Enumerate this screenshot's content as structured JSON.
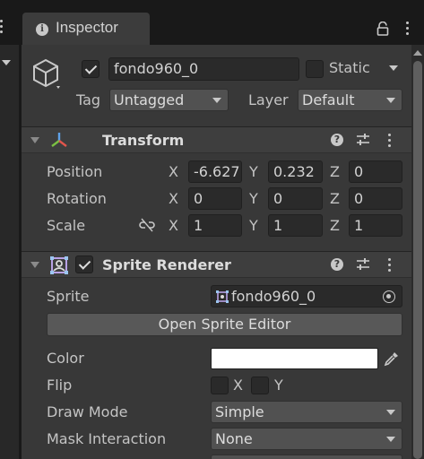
{
  "tab": {
    "title": "Inspector",
    "icon": "info-icon"
  },
  "icons": {
    "lock": "lock-icon",
    "tab_menu": "kebab-menu-icon",
    "gameobject": "cube-icon",
    "transform": "transform-axes-icon",
    "sprite_renderer": "sprite-renderer-icon",
    "help": "help-icon",
    "presets": "preset-sliders-icon",
    "constrain": "link-broken-icon",
    "object_picker": "object-picker-icon",
    "eyedropper": "eyedropper-icon",
    "sprite_asset": "sprite-asset-icon"
  },
  "gameobject": {
    "active": true,
    "name": "fondo960_0",
    "static_label": "Static",
    "static": false,
    "tag_label": "Tag",
    "tag": "Untagged",
    "layer_label": "Layer",
    "layer": "Default"
  },
  "transform": {
    "title": "Transform",
    "rows": [
      {
        "label": "Position",
        "x": "-6.627",
        "y": "0.232",
        "z": "0"
      },
      {
        "label": "Rotation",
        "x": "0",
        "y": "0",
        "z": "0"
      },
      {
        "label": "Scale",
        "x": "1",
        "y": "1",
        "z": "1"
      }
    ],
    "axes": {
      "x": "X",
      "y": "Y",
      "z": "Z"
    }
  },
  "sprite_renderer": {
    "title": "Sprite Renderer",
    "enabled": true,
    "sprite_label": "Sprite",
    "sprite_value": "fondo960_0",
    "open_editor": "Open Sprite Editor",
    "color_label": "Color",
    "color_value": "#ffffff",
    "flip_label": "Flip",
    "flip_x": "X",
    "flip_y": "Y",
    "draw_mode_label": "Draw Mode",
    "draw_mode": "Simple",
    "mask_label": "Mask Interaction",
    "mask": "None"
  },
  "colors": {
    "panel": "#383838",
    "header": "#3e3e3e",
    "field": "#2a2a2a",
    "dropdown": "#515151"
  }
}
